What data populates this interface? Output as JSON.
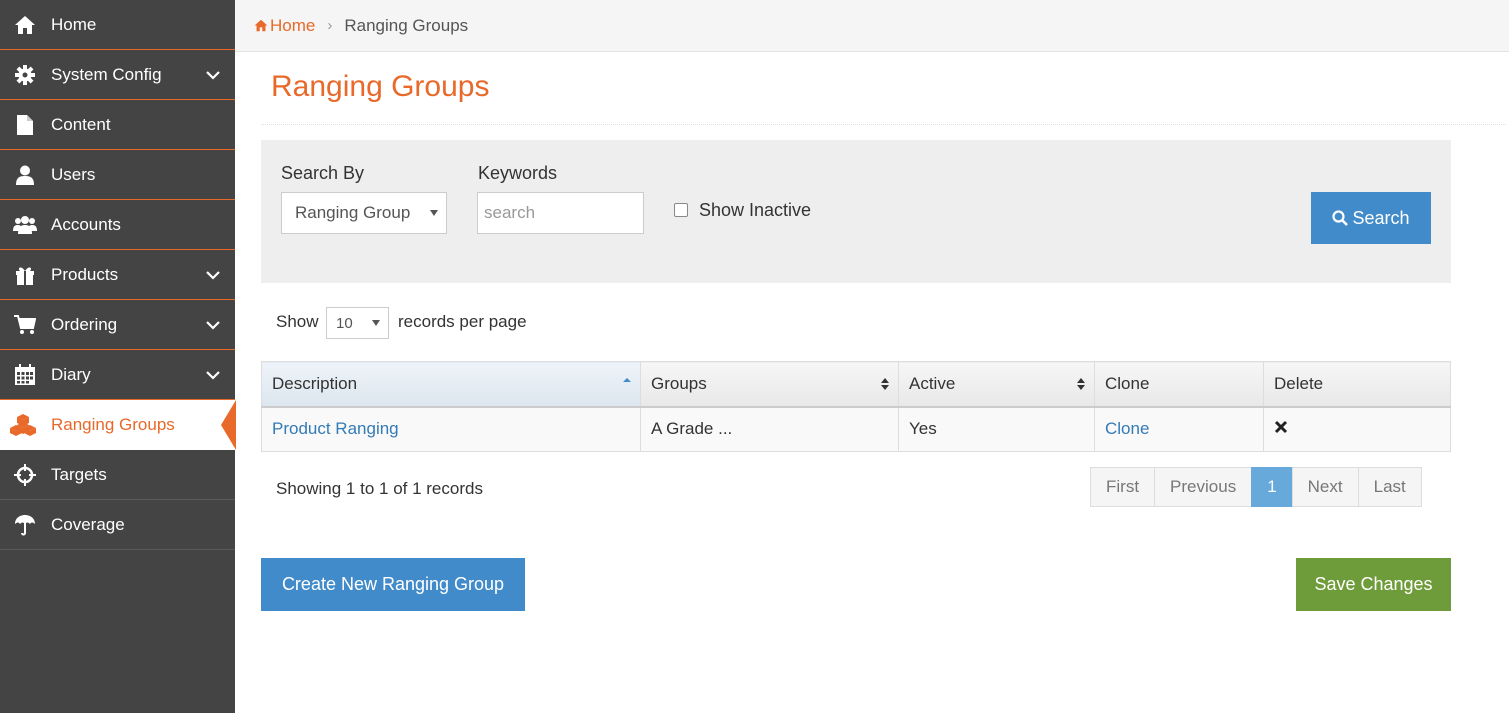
{
  "sidebar": {
    "items": [
      {
        "label": "Home",
        "icon": "home-icon"
      },
      {
        "label": "System Config",
        "icon": "gear-icon",
        "expandable": true
      },
      {
        "label": "Content",
        "icon": "file-icon"
      },
      {
        "label": "Users",
        "icon": "user-icon"
      },
      {
        "label": "Accounts",
        "icon": "users-icon"
      },
      {
        "label": "Products",
        "icon": "gift-icon",
        "expandable": true
      },
      {
        "label": "Ordering",
        "icon": "cart-icon",
        "expandable": true
      },
      {
        "label": "Diary",
        "icon": "calendar-icon",
        "expandable": true
      },
      {
        "label": "Ranging Groups",
        "icon": "cubes-icon",
        "active": true
      },
      {
        "label": "Targets",
        "icon": "crosshairs-icon"
      },
      {
        "label": "Coverage",
        "icon": "umbrella-icon"
      }
    ]
  },
  "breadcrumb": {
    "home": "Home",
    "current": "Ranging Groups"
  },
  "page": {
    "title": "Ranging Groups"
  },
  "search": {
    "search_by_label": "Search By",
    "search_by_value": "Ranging Group",
    "keywords_label": "Keywords",
    "keywords_placeholder": "search",
    "keywords_value": "",
    "show_inactive_label": "Show Inactive",
    "show_inactive_checked": false,
    "search_button": "Search"
  },
  "records": {
    "show_label": "Show",
    "per_page": "10",
    "per_page_label": "records per page"
  },
  "table": {
    "headers": [
      "Description",
      "Groups",
      "Active",
      "Clone",
      "Delete"
    ],
    "rows": [
      {
        "description": "Product Ranging",
        "groups": "A Grade ...",
        "active": "Yes",
        "clone": "Clone",
        "delete": "delete-icon"
      }
    ]
  },
  "summary": "Showing 1 to 1 of 1 records",
  "pagination": {
    "first": "First",
    "previous": "Previous",
    "current": "1",
    "next": "Next",
    "last": "Last"
  },
  "actions": {
    "create": "Create New Ranging Group",
    "save": "Save Changes"
  },
  "colors": {
    "accent": "#e8692a",
    "sidebar": "#444444",
    "primary": "#428bca",
    "success": "#6f9c3a",
    "page_active": "#67a9da"
  }
}
